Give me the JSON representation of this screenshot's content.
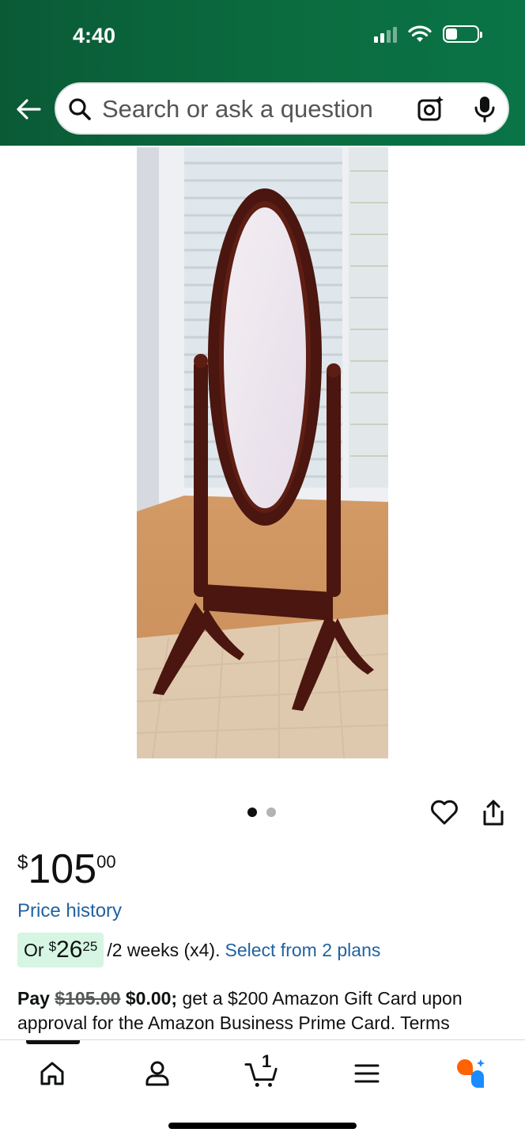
{
  "status_bar": {
    "time": "4:40",
    "icons": [
      "signal-icon",
      "wifi-icon",
      "battery-icon"
    ]
  },
  "header": {
    "back_icon": "back-arrow-icon",
    "search": {
      "placeholder": "Search or ask a question",
      "icons": [
        "search-icon",
        "camera-icon",
        "microphone-icon"
      ]
    },
    "background_color": "#0b6b3f"
  },
  "carousel": {
    "image_count": 2,
    "active_index": 0
  },
  "actions": {
    "icons": [
      "heart-icon",
      "share-icon"
    ]
  },
  "price": {
    "symbol": "$",
    "whole": "105",
    "fraction": "00"
  },
  "price_history_label": "Price history",
  "installment": {
    "prefix": "Or",
    "symbol": "$",
    "whole": "26",
    "fraction": "25",
    "suffix": "/2 weeks (x4).",
    "link": "Select from 2 plans"
  },
  "promo": {
    "pay_label": "Pay",
    "original_price": "$105.00",
    "new_price": "$0.00;",
    "text": "get a $200 Amazon Gift Card upon approval for the Amazon Business Prime Card.",
    "terms": "Terms"
  },
  "bottom_nav": {
    "items": [
      "home-icon",
      "account-icon",
      "cart-icon",
      "menu-icon",
      "rufus-icon"
    ],
    "cart_count": "1",
    "accent_color": "#ff6200",
    "ai_color": "#1a8cff"
  }
}
